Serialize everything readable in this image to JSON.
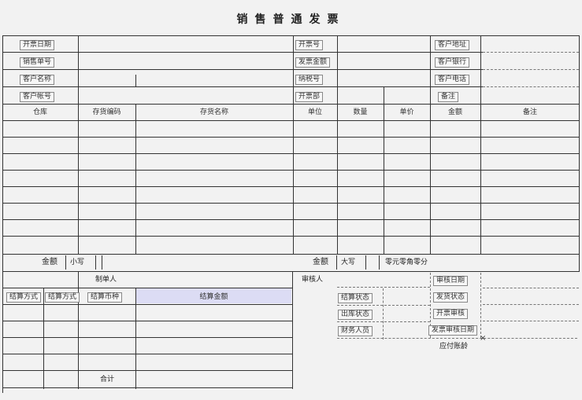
{
  "form": {
    "title": "销售普通发票",
    "header_fields": {
      "invoice_date": "开票日期",
      "sales_no": "销售单号",
      "customer_name": "客户名称",
      "customer_account": "客户帐号",
      "invoice_code": "开票号",
      "invoice_amount": "发票金额",
      "tax_no": "纳税号",
      "dept": "开票部",
      "customer_address": "客户地址",
      "customer_bank": "客户银行",
      "customer_phone": "客户电话",
      "remark": "备注"
    },
    "columns": [
      "仓库",
      "存货编码",
      "存货名称",
      "单位",
      "数量",
      "单价",
      "金额",
      "备注"
    ],
    "row_count": 9,
    "total_label": "金额",
    "total_lower_label": "小写",
    "total_upper_label": "大写",
    "total_upper_value": "零元零角零分",
    "footer_left": {
      "maker_label": "制单人",
      "cols": [
        "结算方式",
        "结算方式",
        "结算币种",
        "结算金额"
      ],
      "sum_label": "合计"
    },
    "footer_mid": {
      "reviewer_label": "审核人",
      "items": [
        "结算状态",
        "出库状态",
        "财务人员"
      ]
    },
    "footer_right": {
      "items": [
        "审核日期",
        "发货状态",
        "开票审核",
        "发票审核日期",
        "应付账龄"
      ]
    }
  }
}
